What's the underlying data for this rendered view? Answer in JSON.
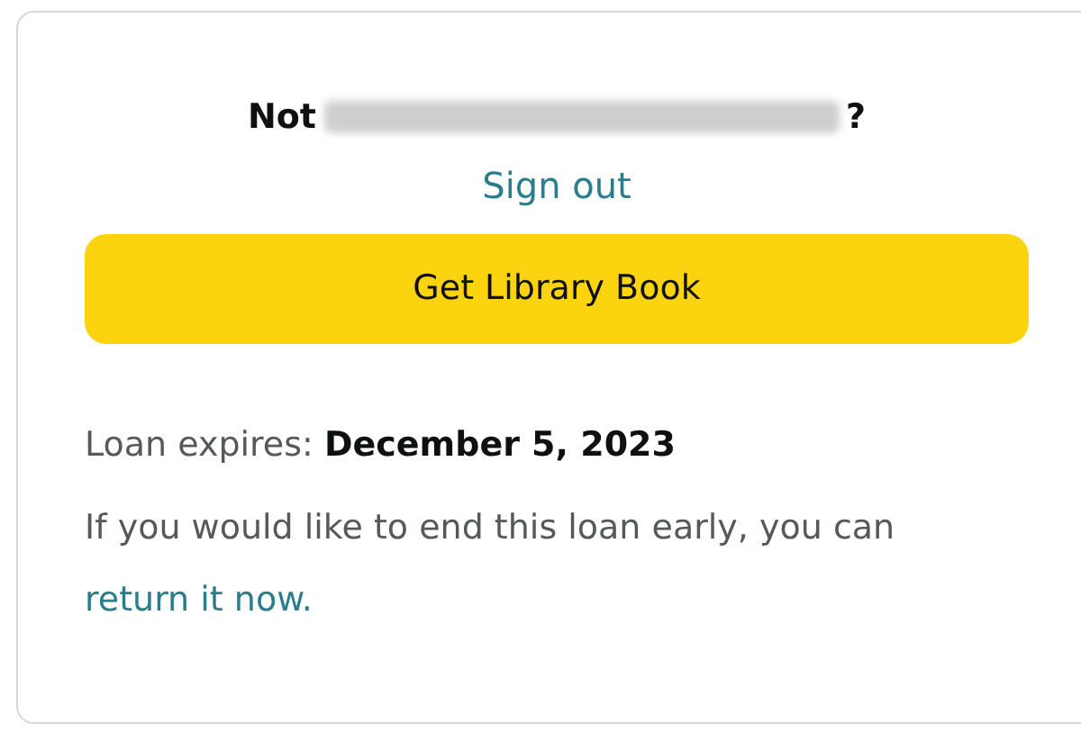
{
  "account": {
    "prefix": "Not",
    "redacted": true,
    "suffix": "?"
  },
  "sign_out": "Sign out",
  "button": "Get Library Book",
  "loan": {
    "label": "Loan expires:",
    "date": "December 5, 2023"
  },
  "return_note": {
    "text": "If you would like to end this loan early, you can",
    "link": "return it now."
  }
}
